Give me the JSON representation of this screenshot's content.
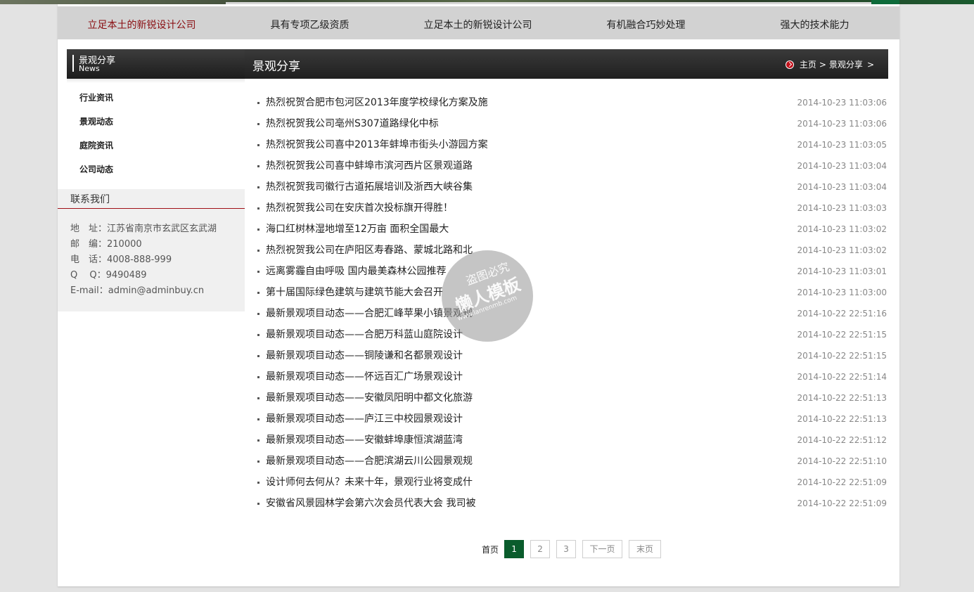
{
  "nav": {
    "items": [
      {
        "label": "立足本土的新锐设计公司"
      },
      {
        "label": "具有专项乙级资质"
      },
      {
        "label": "立足本土的新锐设计公司"
      },
      {
        "label": "有机融合巧妙处理"
      },
      {
        "label": "强大的技术能力"
      }
    ],
    "active_index": 0,
    "active_color": "#8a0e12"
  },
  "sidebar": {
    "heading": "景观分享",
    "heading_en": "News",
    "menu": [
      {
        "label": "行业资讯"
      },
      {
        "label": "景观动态"
      },
      {
        "label": "庭院资讯"
      },
      {
        "label": "公司动态"
      }
    ],
    "contact": {
      "title": "联系我们",
      "lines": [
        "地　址：江苏省南京市玄武区玄武湖",
        "邮　编：210000",
        "电　话：4008-888-999",
        "Q　 Q：9490489",
        "E-mail：admin@adminbuy.cn"
      ]
    }
  },
  "main": {
    "title": "景观分享",
    "breadcrumb": {
      "icon": "arrow-circle-icon",
      "home": "主页",
      "sep": ">",
      "current": "景观分享",
      "trail": ">"
    },
    "articles": [
      {
        "title": "热烈祝贺合肥市包河区2013年度学校绿化方案及施",
        "date": "2014-10-23 11:03:06"
      },
      {
        "title": "热烈祝贺我公司亳州S307道路绿化中标",
        "date": "2014-10-23 11:03:06"
      },
      {
        "title": "热烈祝贺我公司喜中2013年蚌埠市街头小游园方案",
        "date": "2014-10-23 11:03:05"
      },
      {
        "title": "热烈祝贺我公司喜中蚌埠市滨河西片区景观道路",
        "date": "2014-10-23 11:03:04"
      },
      {
        "title": "热烈祝贺我司徽行古道拓展培训及浙西大峡谷集",
        "date": "2014-10-23 11:03:04"
      },
      {
        "title": "热烈祝贺我公司在安庆首次投标旗开得胜！",
        "date": "2014-10-23 11:03:03"
      },
      {
        "title": "海口红树林湿地增至12万亩 面积全国最大",
        "date": "2014-10-23 11:03:02"
      },
      {
        "title": "热烈祝贺我公司在庐阳区寿春路、蒙城北路和北",
        "date": "2014-10-23 11:03:02"
      },
      {
        "title": "远离雾霾自由呼吸 国内最美森林公园推荐",
        "date": "2014-10-23 11:03:01"
      },
      {
        "title": "第十届国际绿色建筑与建筑节能大会召开",
        "date": "2014-10-23 11:03:00"
      },
      {
        "title": "最新景观项目动态——合肥汇峰苹果小镇景观规",
        "date": "2014-10-22 22:51:16"
      },
      {
        "title": "最新景观项目动态——合肥万科蓝山庭院设计",
        "date": "2014-10-22 22:51:15"
      },
      {
        "title": "最新景观项目动态——铜陵谦和名都景观设计",
        "date": "2014-10-22 22:51:15"
      },
      {
        "title": "最新景观项目动态——怀远百汇广场景观设计",
        "date": "2014-10-22 22:51:14"
      },
      {
        "title": "最新景观项目动态——安徽凤阳明中都文化旅游",
        "date": "2014-10-22 22:51:13"
      },
      {
        "title": "最新景观项目动态——庐江三中校园景观设计",
        "date": "2014-10-22 22:51:13"
      },
      {
        "title": "最新景观项目动态——安徽蚌埠康恒滨湖蓝湾",
        "date": "2014-10-22 22:51:12"
      },
      {
        "title": "最新景观项目动态——合肥滨湖云川公园景观规",
        "date": "2014-10-22 22:51:10"
      },
      {
        "title": "设计师何去何从？未来十年，景观行业将变成什",
        "date": "2014-10-22 22:51:09"
      },
      {
        "title": "安徽省风景园林学会第六次会员代表大会 我司被",
        "date": "2014-10-22 22:51:09"
      }
    ]
  },
  "pager": {
    "first": "首页",
    "pages": [
      "1",
      "2",
      "3"
    ],
    "current": "1",
    "next": "下一页",
    "last": "末页",
    "accent": "#0a5c2c"
  },
  "watermark": {
    "line1": "盗图必究",
    "line2": "懒人模板",
    "line3": "www.lanrenmb.com"
  }
}
